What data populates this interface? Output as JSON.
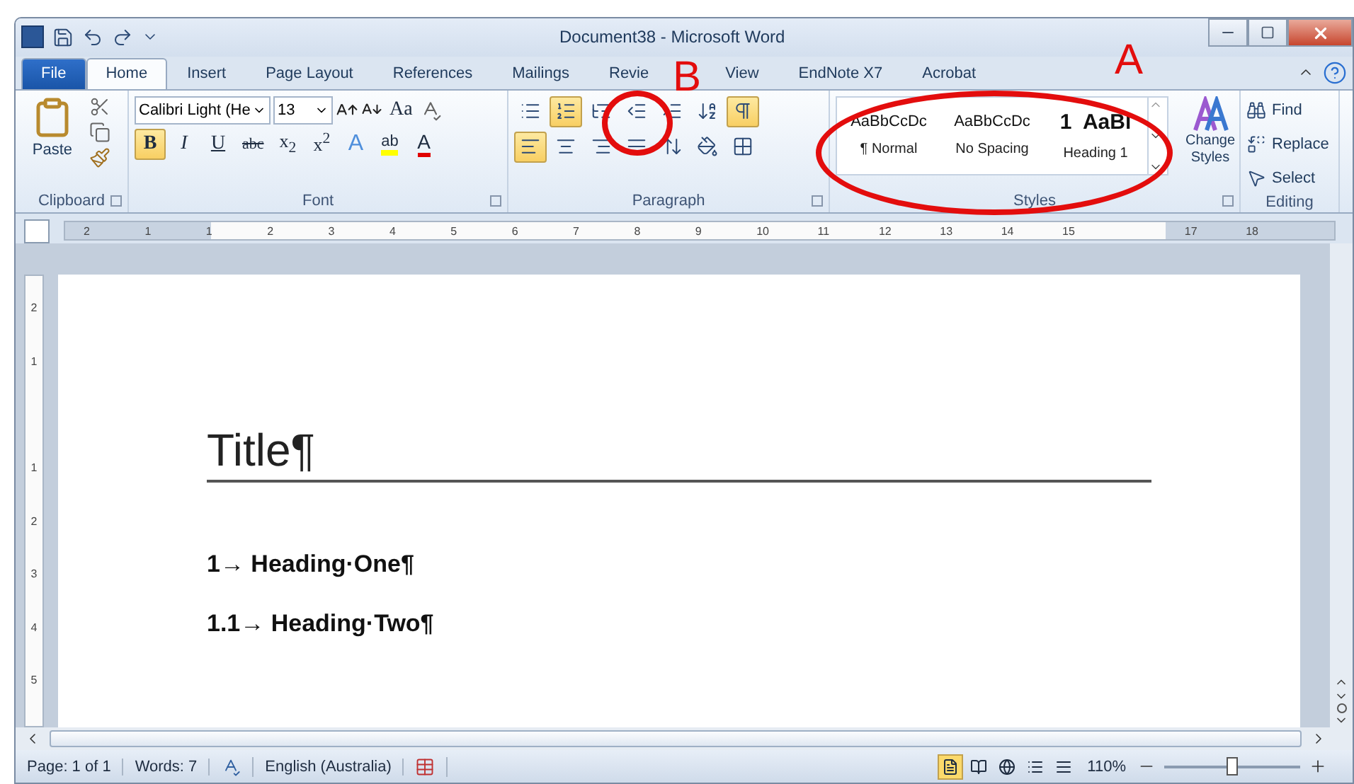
{
  "window": {
    "title": "Document38 - Microsoft Word"
  },
  "tabs": [
    {
      "label": "File",
      "kind": "file",
      "selected": false
    },
    {
      "label": "Home",
      "kind": "tab",
      "selected": true
    },
    {
      "label": "Insert",
      "kind": "tab",
      "selected": false
    },
    {
      "label": "Page Layout",
      "kind": "tab",
      "selected": false
    },
    {
      "label": "References",
      "kind": "tab",
      "selected": false
    },
    {
      "label": "Mailings",
      "kind": "tab",
      "selected": false
    },
    {
      "label": "Revie",
      "kind": "tab",
      "selected": false
    },
    {
      "label": "View",
      "kind": "tab",
      "selected": false
    },
    {
      "label": "EndNote X7",
      "kind": "tab",
      "selected": false
    },
    {
      "label": "Acrobat",
      "kind": "tab",
      "selected": false
    }
  ],
  "clipboard": {
    "paste": "Paste",
    "group": "Clipboard"
  },
  "font": {
    "group": "Font",
    "name": "Calibri Light (He",
    "size": "13",
    "case": "Aa",
    "buttons": [
      {
        "label": "B",
        "kind": "bold",
        "on": true
      },
      {
        "label": "I",
        "kind": "italic",
        "on": false
      },
      {
        "label": "U",
        "kind": "underline",
        "on": false
      },
      {
        "label": "abc",
        "kind": "strike",
        "on": false
      },
      {
        "label": "x$_{2}$",
        "kind": "plain",
        "on": false
      },
      {
        "label": "x$^{2}$",
        "kind": "plain",
        "on": false
      },
      {
        "label": "A",
        "kind": "effect",
        "on": false
      },
      {
        "label": "ab",
        "kind": "highlight",
        "on": false
      },
      {
        "label": "A",
        "kind": "color",
        "on": false
      }
    ]
  },
  "paragraph": {
    "group": "Paragraph",
    "row1": [
      {
        "kind": "bullets",
        "on": false
      },
      {
        "kind": "numbering",
        "on": true
      },
      {
        "kind": "multilevel",
        "on": false
      },
      {
        "kind": "outdent",
        "on": false
      },
      {
        "kind": "indent",
        "on": false
      },
      {
        "kind": "sort",
        "on": false
      },
      {
        "kind": "marks",
        "on": true
      }
    ],
    "row2": [
      {
        "kind": "left",
        "on": true
      },
      {
        "kind": "center",
        "on": false
      },
      {
        "kind": "right",
        "on": false
      },
      {
        "kind": "justify",
        "on": false
      },
      {
        "kind": "spacing",
        "on": false
      },
      {
        "kind": "shading",
        "on": false
      },
      {
        "kind": "borders",
        "on": false
      }
    ]
  },
  "styles": {
    "group": "Styles",
    "change": "Change Styles",
    "items": [
      {
        "preview": "AaBbCcDc",
        "name": "¶ Normal",
        "kind": "normal"
      },
      {
        "preview": "AaBbCcDc",
        "name": "No Spacing",
        "kind": "normal"
      },
      {
        "preview": "1  AaBl",
        "name": "Heading 1",
        "kind": "heading"
      }
    ]
  },
  "editing": {
    "group": "Editing",
    "items": [
      {
        "label": "Find",
        "kind": "find"
      },
      {
        "label": "Replace",
        "kind": "replace"
      },
      {
        "label": "Select",
        "kind": "select"
      }
    ]
  },
  "ruler": {
    "marks": [
      "2",
      "1",
      "1",
      "2",
      "3",
      "4",
      "5",
      "6",
      "7",
      "8",
      "9",
      "10",
      "11",
      "12",
      "13",
      "14",
      "15"
    ],
    "right_marks": [
      "17",
      "18"
    ]
  },
  "vruler": {
    "marks": [
      "2",
      "1",
      "1",
      "2",
      "3",
      "4",
      "5"
    ]
  },
  "document": {
    "title": "Title¶",
    "headings": [
      {
        "text": "1→ Heading·One¶"
      },
      {
        "text": "1.1→ Heading·Two¶"
      }
    ]
  },
  "status_bar": {
    "page": "Page: 1 of 1",
    "words": "Words: 7",
    "language": "English (Australia)",
    "views": [
      {
        "selected": true
      },
      {
        "selected": false
      },
      {
        "selected": false
      },
      {
        "selected": false
      },
      {
        "selected": false
      }
    ],
    "zoom": "110%",
    "zoom_slider": {
      "level": 0.5
    }
  },
  "annotations": [
    {
      "label": "A",
      "kind": "ellipse"
    },
    {
      "label": "B",
      "kind": "circle"
    }
  ]
}
